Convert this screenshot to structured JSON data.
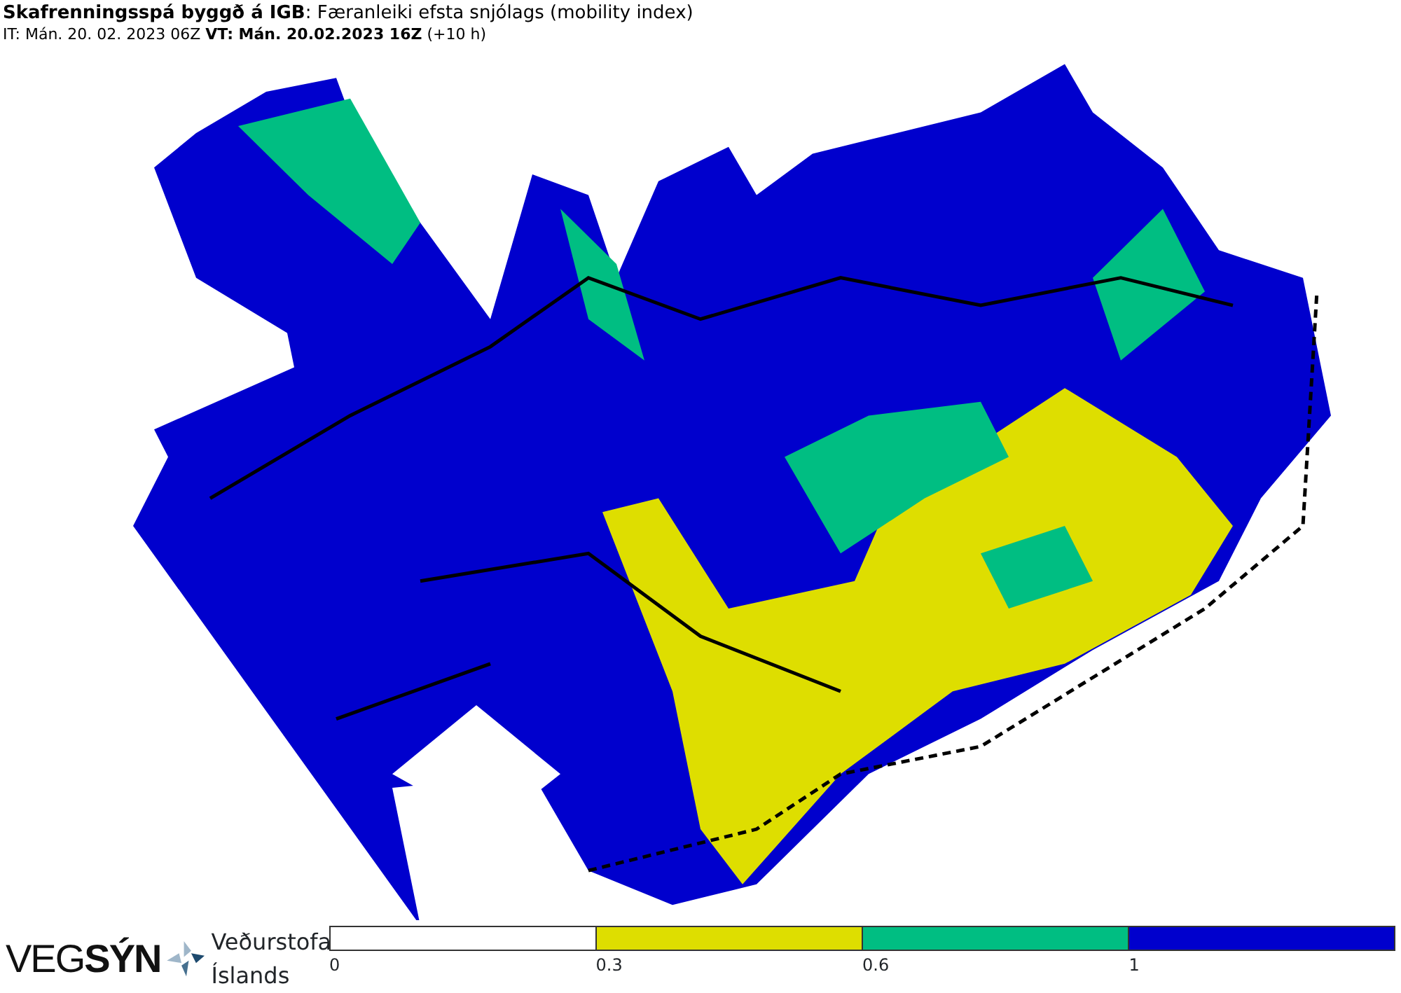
{
  "header": {
    "title": "**Skafrenningsspá byggð á IGB**: Færanleiki efsta snjólags (mobility index)",
    "times": "IT: Mán. 20. 02. 2023 06Z **VT: Mán. 20.02.2023 16Z** (+10 h)"
  },
  "logos": {
    "vegsyn": "VEG**SÝN**",
    "agency_lines": [
      "Veðurstofa",
      "Íslands"
    ]
  },
  "legend": [
    {
      "label": "0",
      "color": "#ffffff"
    },
    {
      "label": "0.3",
      "color": "#dede00"
    },
    {
      "label": "0.6",
      "color": "#00be82"
    },
    {
      "label": "1",
      "color": "#0000cd"
    }
  ]
}
